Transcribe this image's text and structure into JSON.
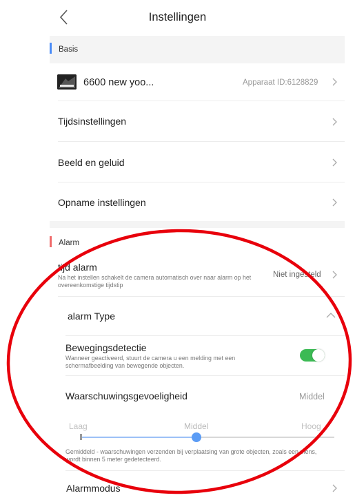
{
  "header": {
    "title": "Instellingen"
  },
  "basis": {
    "section_label": "Basis",
    "device_name": "6600 new yoo...",
    "device_id": "Apparaat ID:6128829",
    "items": [
      {
        "label": "Tijdsinstellingen"
      },
      {
        "label": "Beeld en geluid"
      },
      {
        "label": "Opname instellingen"
      }
    ]
  },
  "alarm": {
    "section_label": "Alarm",
    "time_alarm": {
      "title": "tijd alarm",
      "description": "Na het instellen schakelt de camera automatisch over naar alarm op het overeenkomstige tijdstip",
      "value": "Niet ingesteld"
    },
    "alarm_type_label": "alarm Type",
    "motion": {
      "title": "Bewegingsdetectie",
      "description": "Wanneer geactiveerd, stuurt de camera u een melding met een schermafbeelding van bewegende objecten.",
      "enabled": true
    },
    "sensitivity": {
      "label": "Waarschuwingsgevoeligheid",
      "value": "Middel",
      "levels": [
        "Laag",
        "Middel",
        "Hoog"
      ],
      "selected_index": 1,
      "description": "Gemiddeld - waarschuwingen verzenden bij verplaatsing van grote objecten, zoals een mens, wordt binnen 5 meter gedetecteerd."
    },
    "mode_label": "Alarmmodus"
  },
  "colors": {
    "basis_accent": "#4a8cf7",
    "alarm_accent": "#f06a6a",
    "toggle_on": "#3cba54",
    "slider_active": "#5b9cf5",
    "annotation": "#e8000b"
  }
}
